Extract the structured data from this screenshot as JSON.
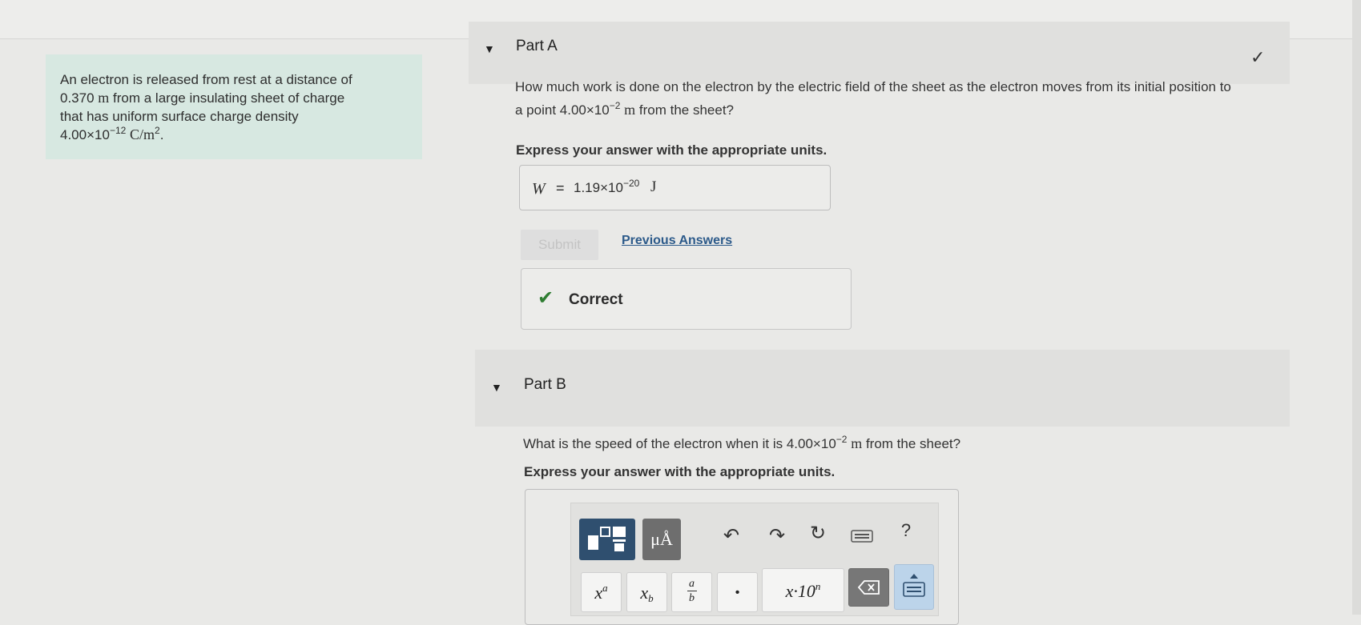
{
  "problem": {
    "line1": "An electron is released from rest at a distance of",
    "line2_num": "0.370",
    "line2_unit": "m",
    "line2_rest": "from a large insulating sheet of charge",
    "line3": "that has uniform surface charge density",
    "line4_num": "4.00×10",
    "line4_exp": "−12",
    "line4_unit": "C/m",
    "line4_unit_exp": "2",
    "line4_end": "."
  },
  "partA": {
    "title": "Part A",
    "question_line1": "How much work is done on the electron by the electric field of the sheet as the electron moves from its initial position to",
    "question_line2_pre": "a point 4.00×10",
    "question_line2_exp": "−2",
    "question_line2_unit": "m",
    "question_line2_post": "from the sheet?",
    "instruction": "Express your answer with the appropriate units.",
    "answer_var": "W",
    "answer_eq": "=",
    "answer_val": "1.19×10",
    "answer_exp": "−20",
    "answer_unit": "J",
    "submit_label": "Submit",
    "previous_answers": "Previous Answers",
    "correct_label": "Correct"
  },
  "partB": {
    "title": "Part B",
    "question_pre": "What is the speed of the electron when it is 4.00×10",
    "question_exp": "−2",
    "question_unit": "m",
    "question_post": "from the sheet?",
    "instruction": "Express your answer with the appropriate units.",
    "toolbar": {
      "units_label": "μÅ",
      "help_label": "?",
      "keys": {
        "power_base": "x",
        "power_exp": "a",
        "sub_base": "x",
        "sub_sub": "b",
        "frac_num": "a",
        "frac_den": "b",
        "dot": "•",
        "sci_base": "x·10",
        "sci_exp": "n"
      }
    }
  }
}
